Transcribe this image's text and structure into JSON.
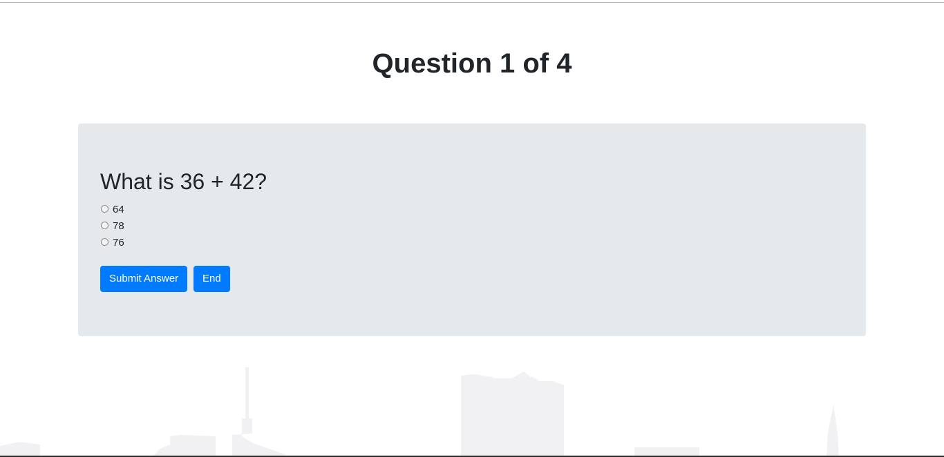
{
  "header": {
    "title": "Question 1 of 4"
  },
  "question": {
    "text": "What is 36 + 42?",
    "options": [
      {
        "label": "64",
        "selected": false
      },
      {
        "label": "78",
        "selected": false
      },
      {
        "label": "76",
        "selected": false
      }
    ]
  },
  "actions": {
    "submit_label": "Submit Answer",
    "end_label": "End"
  },
  "colors": {
    "accent": "#007bff",
    "card_bg": "#e6e9ec",
    "skyline": "#f1f0f2"
  }
}
